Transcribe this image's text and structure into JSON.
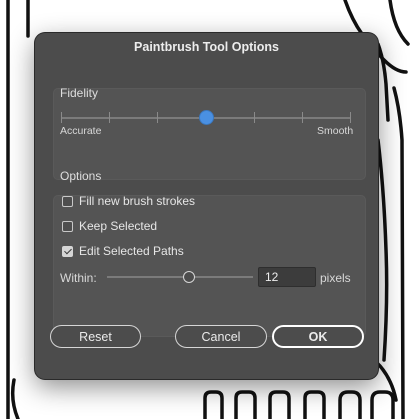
{
  "dialog": {
    "title": "Paintbrush Tool Options",
    "fidelity": {
      "label": "Fidelity",
      "min_label": "Accurate",
      "max_label": "Smooth",
      "value_fraction": 0.5,
      "tick_count": 7
    },
    "options": {
      "label": "Options",
      "fill_new_brush_strokes": {
        "label": "Fill new brush strokes",
        "checked": false
      },
      "keep_selected": {
        "label": "Keep Selected",
        "checked": false
      },
      "edit_selected_paths": {
        "label": "Edit Selected Paths",
        "checked": true
      },
      "within": {
        "label": "Within:",
        "value": "12",
        "unit": "pixels",
        "slider_fraction": 0.56
      }
    },
    "buttons": {
      "reset": "Reset",
      "cancel": "Cancel",
      "ok": "OK"
    }
  },
  "colors": {
    "dialog_bg": "#4c4c4c",
    "accent": "#4a90e2"
  }
}
